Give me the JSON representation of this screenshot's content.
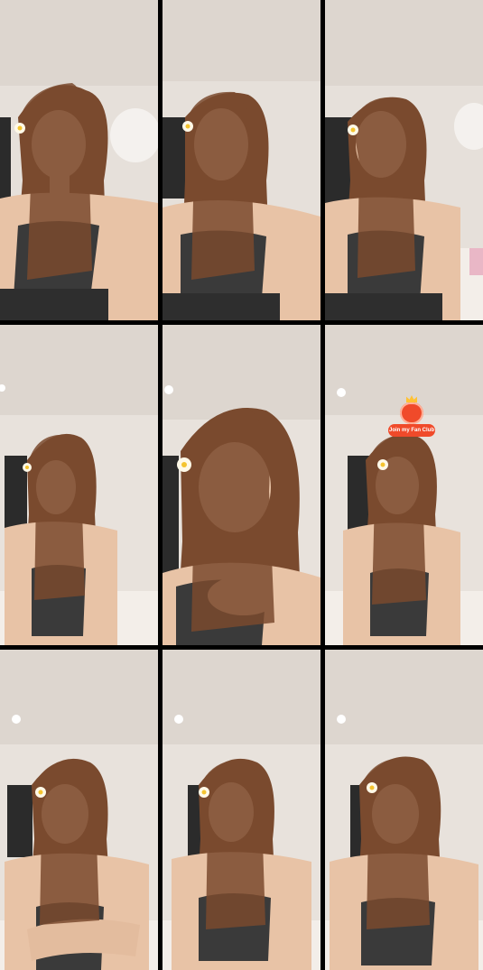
{
  "layout": "3x3 video grid",
  "tiles": [
    {
      "id": 1,
      "flower": true,
      "pose": "talking-lean"
    },
    {
      "id": 2,
      "flower": true,
      "pose": "eyes-closed-talking"
    },
    {
      "id": 3,
      "flower": true,
      "pose": "smiling"
    },
    {
      "id": 4,
      "flower": true,
      "pose": "seated-distant"
    },
    {
      "id": 5,
      "flower": true,
      "pose": "close-up-hand"
    },
    {
      "id": 6,
      "flower": true,
      "pose": "smiling",
      "badge": true
    },
    {
      "id": 7,
      "flower": true,
      "pose": "arms-crossed"
    },
    {
      "id": 8,
      "flower": true,
      "pose": "talking"
    },
    {
      "id": 9,
      "flower": true,
      "pose": "looking-down"
    }
  ],
  "badge": {
    "label": "Join my Fan Club",
    "icon": "heart-crown-icon",
    "color": "#f04a2a"
  },
  "colors": {
    "wall": "#e8e2dc",
    "hair": "#7a4a2e",
    "skin": "#e8c3a6",
    "top": "#3a3a3a"
  }
}
